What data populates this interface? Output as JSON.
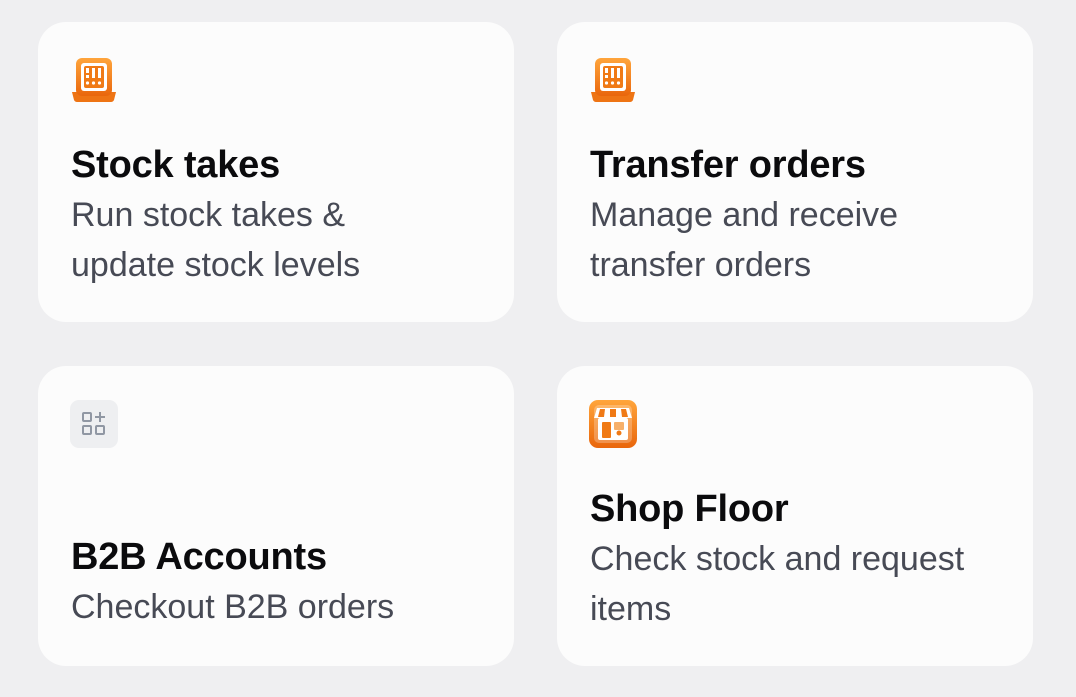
{
  "cards": [
    {
      "title": "Stock takes",
      "subtitle": "Run stock takes &\nupdate stock levels",
      "icon": "stock-counter-icon"
    },
    {
      "title": "Transfer orders",
      "subtitle": "Manage and receive\ntransfer orders",
      "icon": "stock-counter-icon"
    },
    {
      "title": "B2B Accounts",
      "subtitle": "Checkout B2B orders",
      "icon": "apps-add-icon"
    },
    {
      "title": "Shop Floor",
      "subtitle": "Check stock and request\nitems",
      "icon": "storefront-icon"
    }
  ],
  "colors": {
    "background": "#efeff1",
    "card": "#fcfcfc",
    "icon_orange": "#f07a16",
    "icon_gray_bg": "#eeeff1",
    "title": "#0b0b0d",
    "subtitle": "#474a55"
  }
}
